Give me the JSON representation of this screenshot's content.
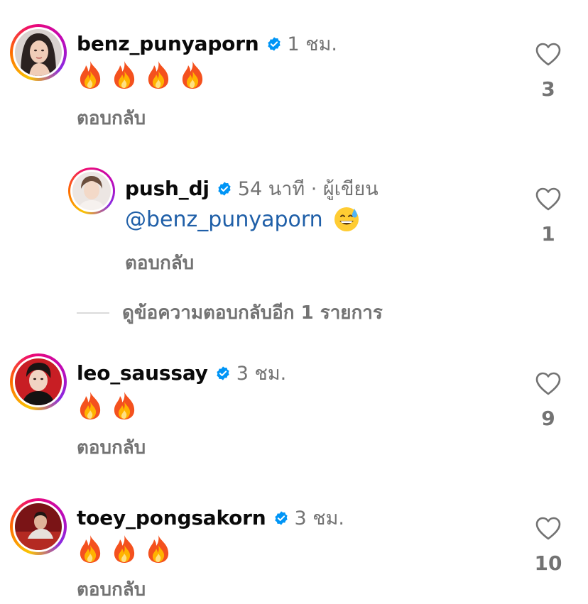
{
  "comments": [
    {
      "username": "benz_punyaporn",
      "time": "1 ชม.",
      "fire_count": 4,
      "reply_label": "ตอบกลับ",
      "likes": "3"
    },
    {
      "username": "push_dj",
      "time": "54 นาที · ผู้เขียน",
      "mention": "@benz_punyaporn",
      "reply_label": "ตอบกลับ",
      "likes": "1"
    },
    {
      "username": "leo_saussay",
      "time": "3 ชม.",
      "fire_count": 2,
      "reply_label": "ตอบกลับ",
      "likes": "9"
    },
    {
      "username": "toey_pongsakorn",
      "time": "3 ชม.",
      "fire_count": 3,
      "reply_label": "ตอบกลับ",
      "likes": "10"
    }
  ],
  "view_more_replies": "ดูข้อความตอบกลับอีก 1 รายการ",
  "colors": {
    "verified": "#0095f6",
    "mention": "#1f5fa8",
    "secondary_text": "#737373"
  }
}
